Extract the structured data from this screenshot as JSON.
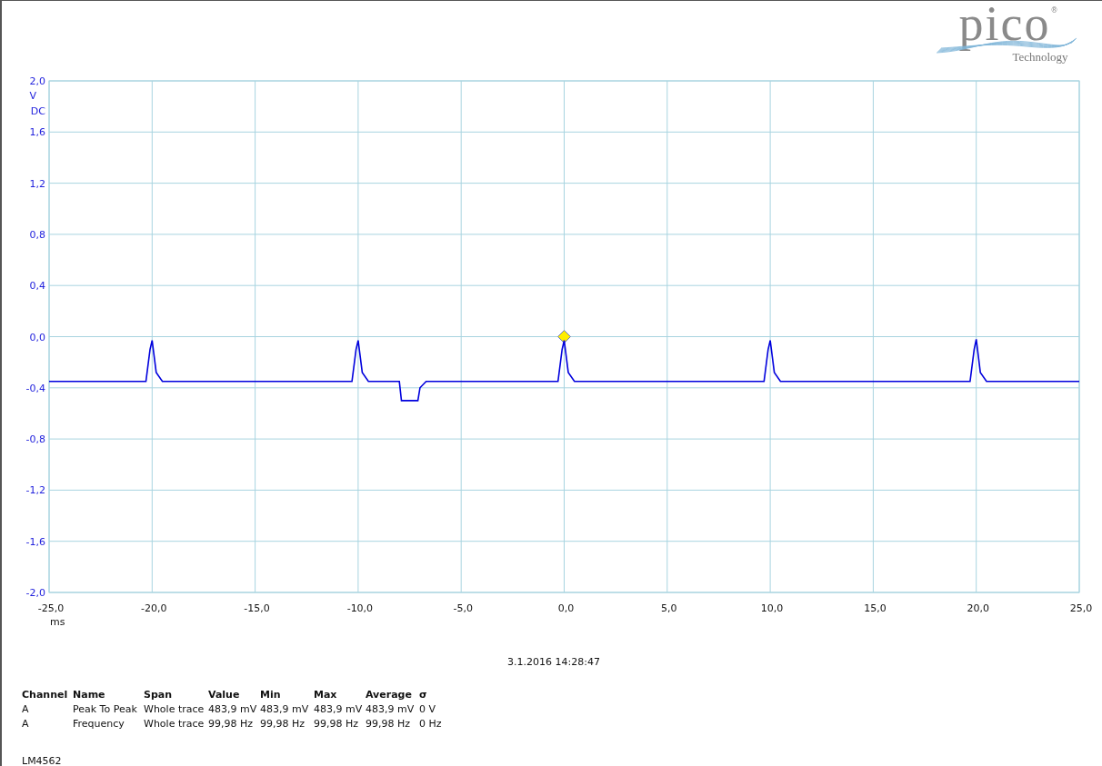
{
  "logo": {
    "name": "pico",
    "mark": "®",
    "subtitle": "Technology"
  },
  "scope": {
    "coupling": "DC",
    "chart_data": {
      "type": "line",
      "xlabel": "ms",
      "ylabel": "V",
      "x": [
        -25,
        -20.3,
        -20.1,
        -20,
        -19.8,
        -19.5,
        -10.3,
        -10.1,
        -10,
        -9.8,
        -9.5,
        -8.0,
        -7.9,
        -7.1,
        -7.0,
        -6.7,
        -0.3,
        -0.1,
        0,
        0.2,
        0.5,
        9.7,
        9.9,
        10,
        10.2,
        10.5,
        19.7,
        19.9,
        20,
        20.2,
        20.5,
        25
      ],
      "grid": true,
      "series": [
        {
          "color": "#0000dd",
          "values": [
            -0.35,
            -0.35,
            -0.1,
            -0.03,
            -0.28,
            -0.35,
            -0.35,
            -0.1,
            -0.03,
            -0.28,
            -0.35,
            -0.35,
            -0.5,
            -0.5,
            -0.4,
            -0.35,
            -0.35,
            -0.1,
            -0.03,
            -0.28,
            -0.35,
            -0.35,
            -0.1,
            -0.03,
            -0.28,
            -0.35,
            -0.35,
            -0.1,
            -0.02,
            -0.28,
            -0.35,
            -0.35
          ]
        }
      ],
      "xlim": [
        -25,
        25
      ],
      "ylim": [
        -2,
        2
      ],
      "xticks": [
        {
          "value": -25,
          "label": "-25,0"
        },
        {
          "value": -20,
          "label": "-20,0"
        },
        {
          "value": -15,
          "label": "-15,0"
        },
        {
          "value": -10,
          "label": "-10,0"
        },
        {
          "value": -5,
          "label": "-5,0"
        },
        {
          "value": 0,
          "label": "0,0"
        },
        {
          "value": 5,
          "label": "5,0"
        },
        {
          "value": 10,
          "label": "10,0"
        },
        {
          "value": 15,
          "label": "15,0"
        },
        {
          "value": 20,
          "label": "20,0"
        },
        {
          "value": 25,
          "label": "25,0"
        }
      ],
      "yticks": [
        {
          "value": 2,
          "label": "2,0"
        },
        {
          "value": 1.6,
          "label": "1,6"
        },
        {
          "value": 1.2,
          "label": "1,2"
        },
        {
          "value": 0.8,
          "label": "0,8"
        },
        {
          "value": 0.4,
          "label": "0,4"
        },
        {
          "value": 0,
          "label": "0,0"
        },
        {
          "value": -0.4,
          "label": "-0,4"
        },
        {
          "value": -0.8,
          "label": "-0,8"
        },
        {
          "value": -1.2,
          "label": "-1,2"
        },
        {
          "value": -1.6,
          "label": "-1,6"
        },
        {
          "value": -2,
          "label": "-2,0"
        }
      ]
    },
    "trigger_marker": {
      "shown": true
    }
  },
  "timestamp": "3.1.2016 14:28:47",
  "measurements": {
    "columns": [
      "Channel",
      "Name",
      "Span",
      "Value",
      "Min",
      "Max",
      "Average",
      "σ"
    ],
    "rows": [
      [
        "A",
        "Peak To Peak",
        "Whole trace",
        "483,9 mV",
        "483,9 mV",
        "483,9 mV",
        "483,9 mV",
        "0 V"
      ],
      [
        "A",
        "Frequency",
        "Whole trace",
        "99,98 Hz",
        "99,98 Hz",
        "99,98 Hz",
        "99,98 Hz",
        "0 Hz"
      ]
    ]
  },
  "footer": "LM4562"
}
